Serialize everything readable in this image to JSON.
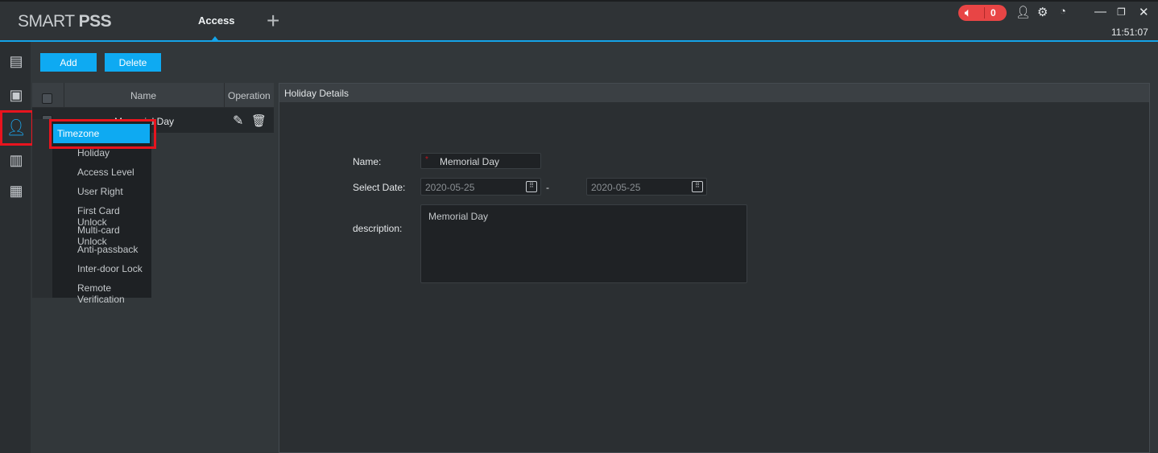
{
  "app": {
    "logo_light": "SMART ",
    "logo_bold": "PSS",
    "tab": "Access",
    "add_tab": "+",
    "alarm_count": "0",
    "clock": "11:51:07"
  },
  "toolbar": {
    "add": "Add",
    "delete": "Delete"
  },
  "table": {
    "headers": [
      "Name",
      "Operation"
    ],
    "rows": [
      {
        "name": "Memorial Day"
      }
    ]
  },
  "menu": {
    "items": [
      "Timezone",
      "Holiday",
      "Access Level",
      "User Right",
      "First Card Unlock",
      "Multi-card Unlock",
      "Anti-passback",
      "Inter-door Lock",
      "Remote Verification"
    ],
    "selected": "Timezone"
  },
  "details": {
    "title": "Holiday Details",
    "name_label": "Name:",
    "name_value": "Memorial Day",
    "required_mark": "*",
    "date_label": "Select Date:",
    "start_date": "2020-05-25",
    "end_date": "2020-05-25",
    "date_sep": "-",
    "desc_label": "description:",
    "desc_value": "Memorial Day"
  },
  "colors": {
    "accent": "#0eaaf2",
    "highlight": "#e8141e",
    "alarm": "#e84545"
  }
}
